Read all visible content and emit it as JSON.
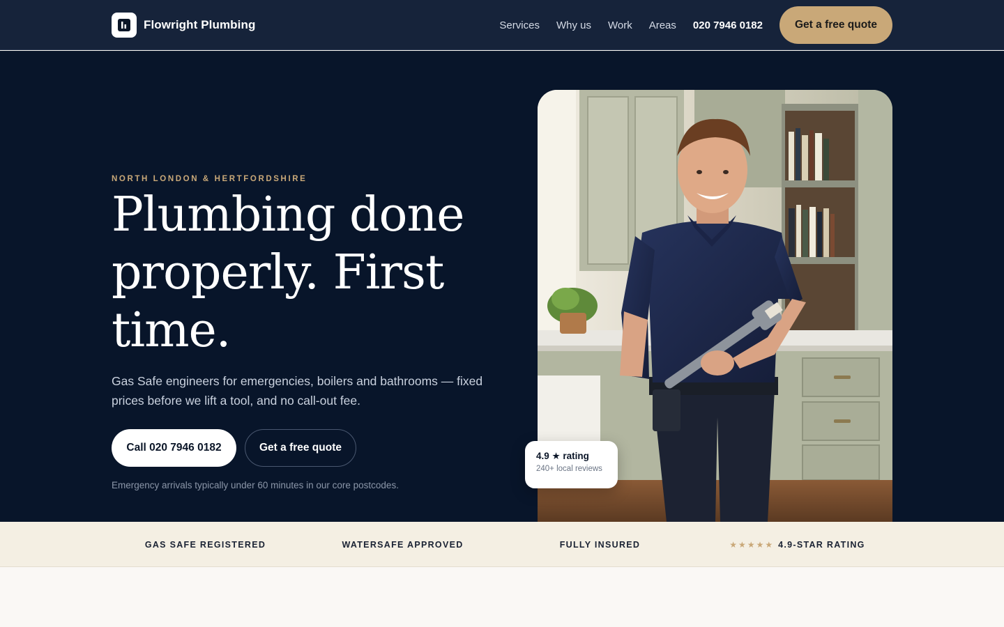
{
  "brand": {
    "name": "Flowright Plumbing",
    "logo_icon": "bars-logo-icon"
  },
  "nav": {
    "items": [
      {
        "label": "Services"
      },
      {
        "label": "Why us"
      },
      {
        "label": "Work"
      },
      {
        "label": "Areas"
      }
    ],
    "phone": "020 7946 0182",
    "cta": "Get a free quote"
  },
  "hero": {
    "eyebrow": "NORTH LONDON & HERTFORDSHIRE",
    "headline_lines": [
      "Plumbing done",
      "properly. First",
      "time."
    ],
    "subtext": "Gas Safe engineers for emergencies, boilers and bathrooms — fixed prices before we lift a tool, and no call-out fee.",
    "call_button": "Call 020 7946 0182",
    "quote_button": "Get a free quote",
    "note": "Emergency arrivals typically under 60 minutes in our core postcodes."
  },
  "rating_card": {
    "title": "4.9 ★ rating",
    "subtitle": "240+ local reviews"
  },
  "trust_bar": {
    "items": [
      {
        "label": "GAS SAFE REGISTERED"
      },
      {
        "label": "WATERSAFE APPROVED"
      },
      {
        "label": "FULLY INSURED"
      },
      {
        "label": "4.9-STAR RATING",
        "stars": "★★★★★"
      }
    ]
  },
  "colors": {
    "header_bg": "#16233a",
    "hero_bg": "#08152a",
    "accent_gold": "#c9a878",
    "trust_bg": "#f4efe3"
  }
}
